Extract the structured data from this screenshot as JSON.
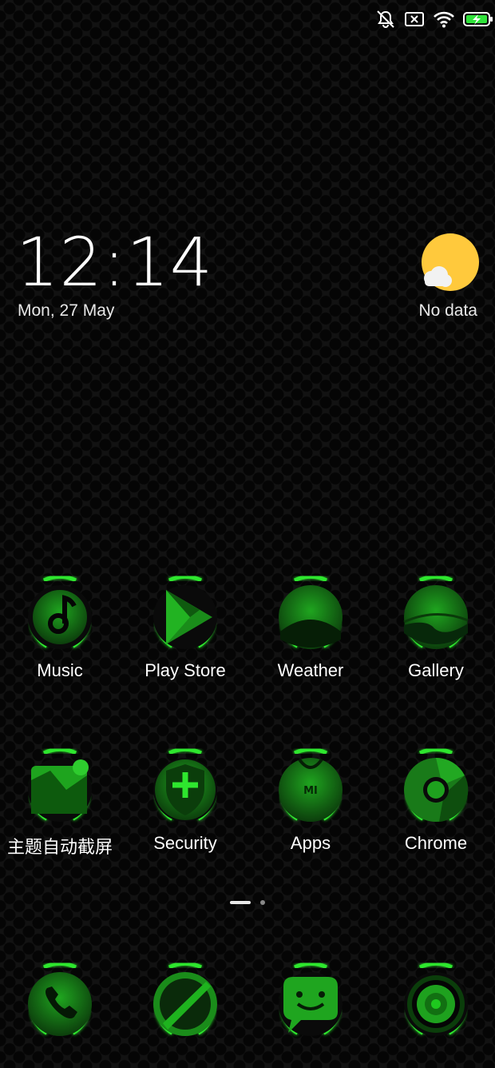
{
  "status_bar": {
    "icons": [
      "bell-off-icon",
      "no-sim-icon",
      "wifi-icon",
      "battery-charging-icon"
    ]
  },
  "clock": {
    "time": "12:14",
    "date": "Mon, 27 May"
  },
  "weather": {
    "text": "No data",
    "icon": "sun-cloud-icon"
  },
  "apps_row1": [
    {
      "label": "Music",
      "icon": "music-note-icon"
    },
    {
      "label": "Play Store",
      "icon": "play-store-icon"
    },
    {
      "label": "Weather",
      "icon": "weather-landscape-icon"
    },
    {
      "label": "Gallery",
      "icon": "gallery-icon"
    }
  ],
  "apps_row2": [
    {
      "label": "主题自动截屏",
      "icon": "screenshot-icon"
    },
    {
      "label": "Security",
      "icon": "shield-plus-icon"
    },
    {
      "label": "Apps",
      "icon": "mi-bag-icon",
      "badge": "MI"
    },
    {
      "label": "Chrome",
      "icon": "chrome-icon"
    }
  ],
  "dock": [
    {
      "icon": "phone-icon"
    },
    {
      "icon": "browser-icon"
    },
    {
      "icon": "messages-icon"
    },
    {
      "icon": "camera-icon"
    }
  ],
  "page_indicator": {
    "pages": 2,
    "current": 1
  },
  "colors": {
    "accent": "#1ed71e",
    "dark_green": "#0b4a0b",
    "sun": "#ffc93c"
  }
}
